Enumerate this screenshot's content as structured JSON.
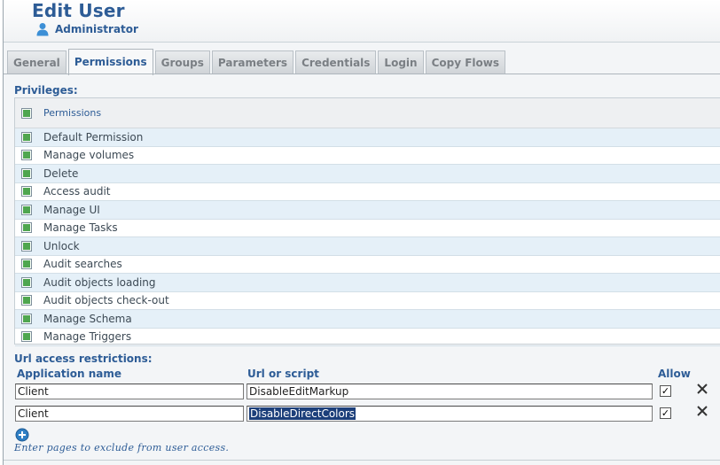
{
  "header": {
    "title": "Edit User",
    "user": "Administrator"
  },
  "tabs": [
    {
      "label": "General"
    },
    {
      "label": "Permissions"
    },
    {
      "label": "Groups"
    },
    {
      "label": "Parameters"
    },
    {
      "label": "Credentials"
    },
    {
      "label": "Login"
    },
    {
      "label": "Copy Flows"
    }
  ],
  "active_tab": "Permissions",
  "privileges": {
    "section_label": "Privileges:",
    "header_label": "Permissions",
    "items": [
      {
        "label": "Default Permission",
        "checked": true
      },
      {
        "label": "Manage volumes",
        "checked": true
      },
      {
        "label": "Delete",
        "checked": true
      },
      {
        "label": "Access audit",
        "checked": true
      },
      {
        "label": "Manage UI",
        "checked": true
      },
      {
        "label": "Manage Tasks",
        "checked": true
      },
      {
        "label": "Unlock",
        "checked": true
      },
      {
        "label": "Audit searches",
        "checked": true
      },
      {
        "label": "Audit objects loading",
        "checked": true
      },
      {
        "label": "Audit objects check-out",
        "checked": true
      },
      {
        "label": "Manage Schema",
        "checked": true
      },
      {
        "label": "Manage Triggers",
        "checked": true
      }
    ]
  },
  "url_restrictions": {
    "section_label": "Url access restrictions:",
    "col_app": "Application name",
    "col_url": "Url or script",
    "col_allow": "Allow",
    "rows": [
      {
        "app": "Client",
        "url": "DisableEditMarkup",
        "allow": true
      },
      {
        "app": "Client",
        "url": "DisableDirectColors",
        "allow": true
      }
    ],
    "hint": "Enter pages to exclude from user access."
  },
  "colors": {
    "accent": "#2d5c96",
    "check_green": "#4fa64f",
    "row_alt": "#e5f0f8"
  },
  "icons": {
    "user": "user-icon",
    "remove": "close-icon",
    "add": "add-circle-icon"
  }
}
